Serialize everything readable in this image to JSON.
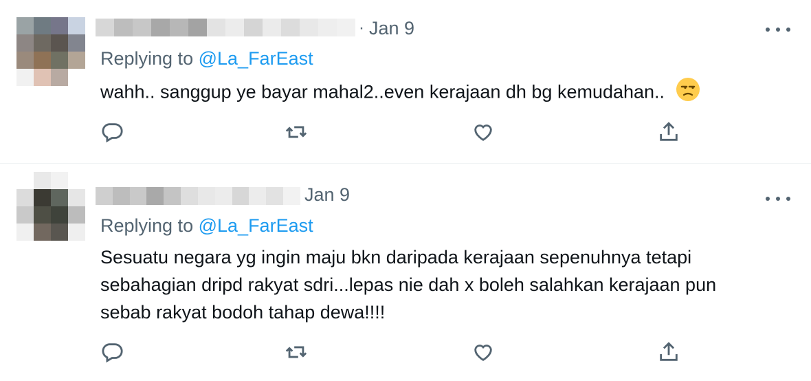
{
  "tweets": [
    {
      "date": "Jan 9",
      "separator": "·",
      "replying_prefix": "Replying to",
      "replying_handle": "@La_FarEast",
      "text": "wahh.. sanggup ye bayar mahal2..even kerajaan dh bg kemudahan..",
      "emoji": "unamused-face-icon",
      "avatar_colors": [
        "#9aa3a5",
        "#6f7b82",
        "#76768a",
        "#c9d3e2",
        "#8d8684",
        "#6e6961",
        "#5b5550",
        "#82858f",
        "#9a8a7c",
        "#8f7256",
        "#707163",
        "#b3a596",
        "#f1f1f1",
        "#e0c2b4",
        "#b8aaa2",
        "#ffffff"
      ],
      "name_colors": [
        "#d7d7d7",
        "#bdbdbd",
        "#c7c7c7",
        "#a8a8a8",
        "#b7b7b7",
        "#a3a3a3",
        "#e3e3e3",
        "#ececec",
        "#d5d5d5",
        "#ebebeb",
        "#dcdcdc",
        "#e8e8e8",
        "#eeeeee",
        "#f1f1f1"
      ]
    },
    {
      "date": "Jan 9",
      "replying_prefix": "Replying to",
      "replying_handle": "@La_FarEast",
      "text_lines": [
        "Sesuatu negara yg ingin maju bkn daripada kerajaan sepenuhnya tetapi",
        "sebahagian dripd rakyat sdri...lepas nie dah x boleh salahkan kerajaan pun",
        "sebab rakyat bodoh tahap dewa!!!!"
      ],
      "avatar_colors": [
        "#ffffff",
        "#e9e9e9",
        "#f2f2f2",
        "#ffffff",
        "#dcdcdc",
        "#3b3a33",
        "#5f665e",
        "#e6e6e6",
        "#c9c9c9",
        "#4e4f45",
        "#3f433b",
        "#bcbcbc",
        "#f0f0f0",
        "#72685f",
        "#595650",
        "#efefef"
      ],
      "name_colors": [
        "#cfcfcf",
        "#bdbdbd",
        "#c9c9c9",
        "#a9a9a9",
        "#c4c4c4",
        "#dedede",
        "#e8e8e8",
        "#ececec",
        "#d7d7d7",
        "#ececec",
        "#e2e2e2",
        "#f2f2f2"
      ]
    }
  ],
  "action_icons": [
    "reply-icon",
    "retweet-icon",
    "like-icon",
    "share-icon"
  ],
  "colors": {
    "link": "#1d9bf0",
    "muted": "#536471",
    "text": "#0f1419",
    "divider": "#eff3f4"
  }
}
